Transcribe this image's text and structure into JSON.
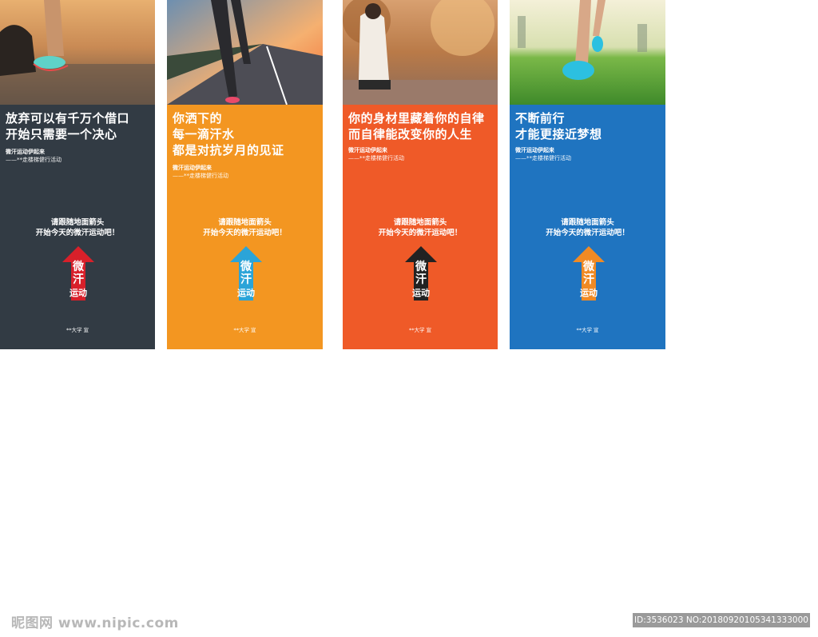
{
  "banners": [
    {
      "bg_color": "#323b44",
      "arrow_color": "#d8202a",
      "headline": "放弃可以有千万个借口\n开始只需要一个决心",
      "tagline": "微汗运动伊起来",
      "event": "——**走楼梯健行活动",
      "instruction_line1": "请跟随地面箭头",
      "instruction_line2": "开始今天的微汗运动吧！",
      "arrow_logo": "微汗运动",
      "issuer": "**大学 宣"
    },
    {
      "bg_color": "#f39621",
      "arrow_color": "#2ba4d8",
      "headline": "你洒下的\n每一滴汗水\n都是对抗岁月的见证",
      "tagline": "微汗运动伊起来",
      "event": "——**走楼梯健行活动",
      "instruction_line1": "请跟随地面箭头",
      "instruction_line2": "开始今天的微汗运动吧！",
      "arrow_logo": "微汗运动",
      "issuer": "**大学 宣"
    },
    {
      "bg_color": "#ef5a28",
      "arrow_color": "#222222",
      "headline": "你的身材里藏着你的自律\n而自律能改变你的人生",
      "tagline": "微汗运动伊起来",
      "event": "——**走楼梯健行活动",
      "instruction_line1": "请跟随地面箭头",
      "instruction_line2": "开始今天的微汗运动吧！",
      "arrow_logo": "微汗运动",
      "issuer": "**大学 宣"
    },
    {
      "bg_color": "#1f74c0",
      "arrow_color": "#f08a24",
      "headline": "不断前行\n才能更接近梦想",
      "tagline": "微汗运动伊起来",
      "event": "——**走楼梯健行活动",
      "instruction_line1": "请跟随地面箭头",
      "instruction_line2": "开始今天的微汗运动吧！",
      "arrow_logo": "微汗运动",
      "issuer": "**大学 宣"
    }
  ],
  "watermark": {
    "site": "昵图网 www.nipic.com",
    "id_text": "ID:3536023 NO:20180920105341333000"
  }
}
